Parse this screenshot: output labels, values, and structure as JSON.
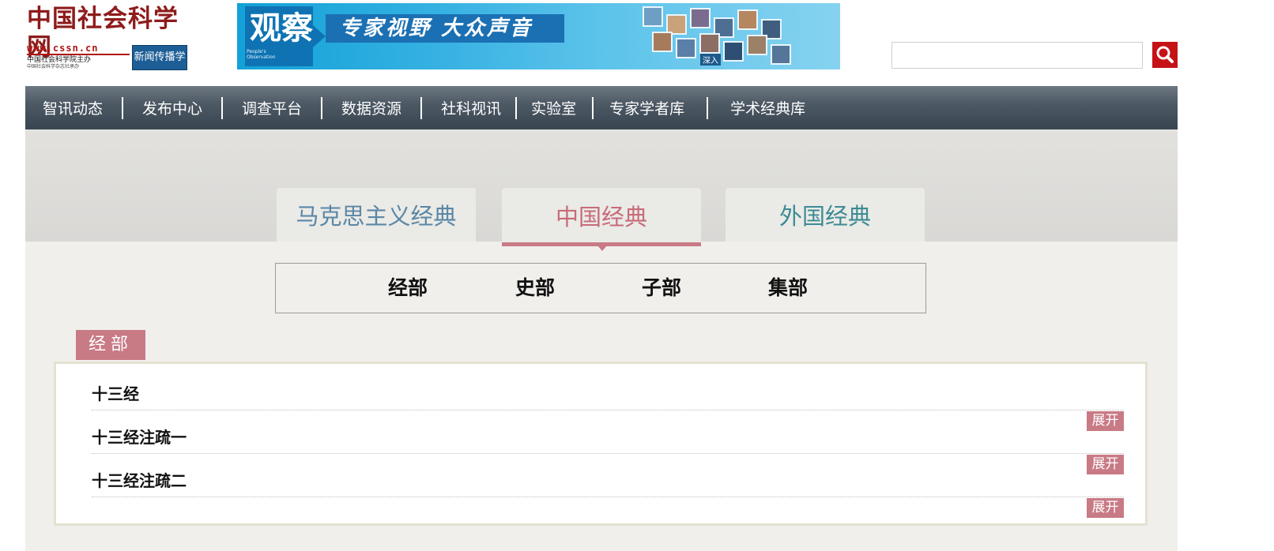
{
  "header": {
    "logo": {
      "title": "中国社会科学网",
      "url": "www.cssn.cn",
      "sub1": "中国社会科学院主办",
      "sub2": "中国社会科学杂志社承办",
      "badge": "新闻传播学"
    },
    "banner": {
      "logo_text": "观察",
      "logo_sub": "People's Observation",
      "slogan": "专家视野 大众声音",
      "cube_label": "深入"
    },
    "search": {
      "placeholder": "",
      "value": "",
      "icon": "search-icon",
      "button_color": "#c51217"
    }
  },
  "nav": {
    "items": [
      {
        "label": "智讯动态"
      },
      {
        "label": "发布中心"
      },
      {
        "label": "调查平台"
      },
      {
        "label": "数据资源"
      },
      {
        "label": "社科视讯"
      },
      {
        "label": "实验室"
      },
      {
        "label": "专家学者库"
      },
      {
        "label": "学术经典库"
      }
    ]
  },
  "tabs": {
    "items": [
      {
        "label": "马克思主义经典",
        "color": "#5b87a6",
        "active": false
      },
      {
        "label": "中国经典",
        "color": "#c86b79",
        "active": true
      },
      {
        "label": "外国经典",
        "color": "#3d8b95",
        "active": false
      }
    ]
  },
  "subnav": {
    "items": [
      {
        "label": "经部"
      },
      {
        "label": "史部"
      },
      {
        "label": "子部"
      },
      {
        "label": "集部"
      }
    ]
  },
  "section": {
    "label": "经部",
    "items": [
      {
        "title": "十三经",
        "action": "展开"
      },
      {
        "title": "十三经注疏一",
        "action": "展开"
      },
      {
        "title": "十三经注疏二",
        "action": "展开"
      }
    ]
  },
  "colors": {
    "accent": "#c87a85",
    "nav_bg": "#4d5964",
    "brand_red": "#b01616"
  }
}
